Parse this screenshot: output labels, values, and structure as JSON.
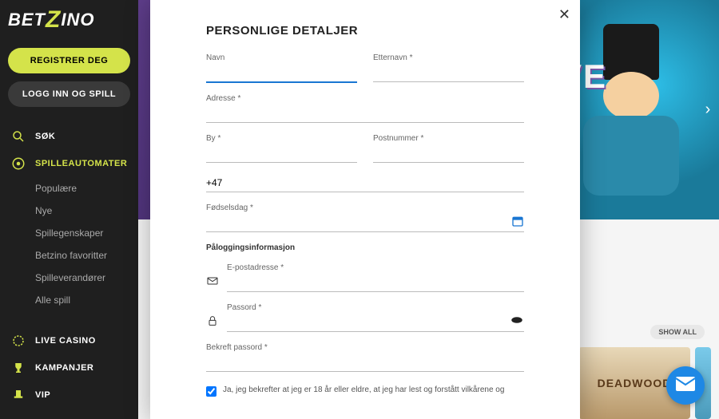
{
  "logo": {
    "pre": "BET",
    "z": "Z",
    "post": "INO"
  },
  "sidebar": {
    "register_label": "REGISTRER DEG",
    "login_label": "LOGG INN OG SPILL",
    "search_label": "SØK",
    "slots_label": "SPILLEAUTOMATER",
    "slots_sub": [
      {
        "label": "Populære"
      },
      {
        "label": "Nye"
      },
      {
        "label": "Spillegenskaper"
      },
      {
        "label": "Betzino favoritter"
      },
      {
        "label": "Spilleverandører"
      },
      {
        "label": "Alle spill"
      }
    ],
    "live_label": "LIVE CASINO",
    "promo_label": "KAMPANJER",
    "vip_label": "VIP"
  },
  "hero": {
    "title": "LIVE"
  },
  "below": {
    "show_all": "SHOW ALL",
    "tile_label": "DEADWOOD"
  },
  "modal": {
    "title": "PERSONLIGE DETALJER",
    "firstname_label": "Navn",
    "lastname_label": "Etternavn *",
    "address_label": "Adresse *",
    "city_label": "By *",
    "postcode_label": "Postnummer *",
    "phone_prefix": "+47",
    "birthday_label": "Fødselsdag *",
    "section_login": "Påloggingsinformasjon",
    "email_label": "E-postadresse *",
    "password_label": "Passord *",
    "confirm_label": "Bekreft passord *",
    "consent_label": "Ja, jeg bekrefter at jeg er 18 år eller eldre, at jeg har lest og forstått vilkårene og"
  }
}
